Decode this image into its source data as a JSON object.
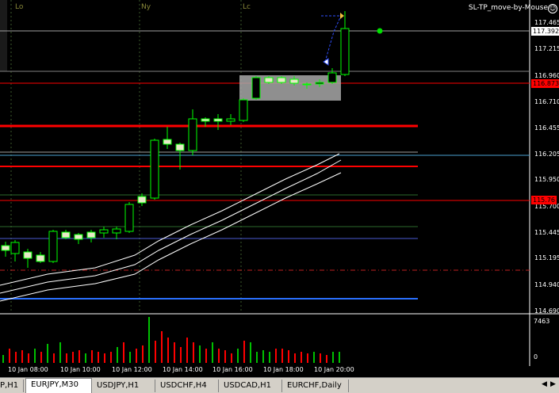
{
  "chart": {
    "ea_name": "SL-TP_move-by-Mouse",
    "sessions": [
      "Lo",
      "Ny",
      "Lc"
    ],
    "price_scale": [
      "117.465",
      "117.215",
      "116.960",
      "116.710",
      "116.455",
      "116.205",
      "115.950",
      "115.700",
      "115.445",
      "115.195",
      "114.940",
      "114.690"
    ],
    "price_tags": [
      {
        "text": "117.392",
        "bg": "#ffffff",
        "fg": "#000000"
      },
      {
        "text": "116.873",
        "bg": "#ff0000",
        "fg": "#000000"
      },
      {
        "text": "115.76",
        "bg": "#ff0000",
        "fg": "#000000"
      }
    ],
    "time_scale": [
      "10 Jan 08:00",
      "10 Jan 10:00",
      "10 Jan 12:00",
      "10 Jan 14:00",
      "10 Jan 16:00",
      "10 Jan 18:00",
      "10 Jan 20:00"
    ],
    "volume_max": "7463",
    "volume_zero": "0",
    "colors": {
      "bull": "#00ff00",
      "bear": "#ff0000",
      "volume_up": "#00c000",
      "volume_down": "#ff0000"
    }
  },
  "tabs": [
    {
      "label": "P,H1"
    },
    {
      "label": "EURJPY,M30",
      "active": true
    },
    {
      "label": "USDJPY,H1"
    },
    {
      "label": "USDCHF,H4"
    },
    {
      "label": "USDCAD,H1"
    },
    {
      "label": "EURCHF,Daily"
    }
  ],
  "nav_icons": [
    "scroll-left-icon",
    "scroll-right-icon"
  ]
}
